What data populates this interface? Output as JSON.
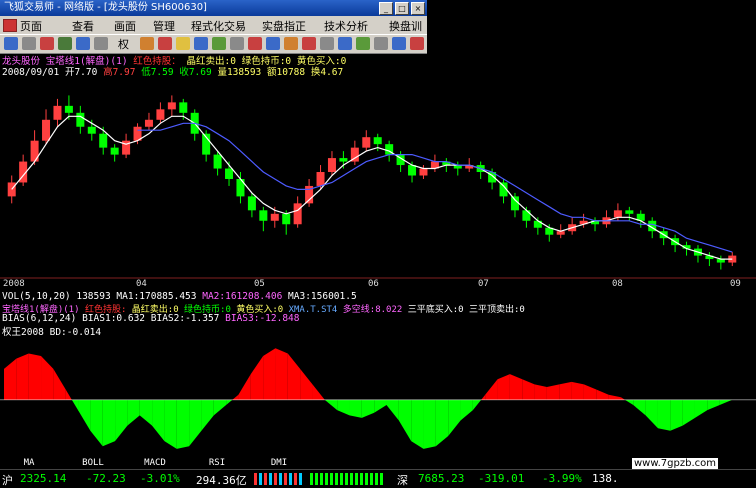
{
  "window": {
    "title": "飞狐交易师 - 网络版 - [龙头股份 SH600630]"
  },
  "menu": [
    "页面",
    "查看",
    "画面",
    "管理",
    "程式化交易",
    "实盘指正",
    "技术分析",
    "换盘训"
  ],
  "toolbar": {
    "right_button": "权"
  },
  "chart_header": {
    "line1_name": "龙头股份  宝塔线1(解盘)(1)",
    "line1_red": "红色持股：",
    "line1_rest": "晶红卖出:0  绿色持币:0  黄色买入:0",
    "line2_date": "2008/09/01",
    "line2_open": "开7.70",
    "line2_high": "高7.97",
    "line2_low": "低7.59",
    "line2_close": "收7.69",
    "line2_vol": "量138593",
    "line2_amt": "额10788",
    "line2_turn": "换4.67"
  },
  "x_axis_labels": [
    "2008",
    "04",
    "05",
    "06",
    "07",
    "08",
    "09"
  ],
  "vol_line": {
    "name": "VOL(5,10,20)  138593",
    "ma1": "MA1:170885.453",
    "ma2": "MA2:161208.406",
    "ma3": "MA3:156001.5"
  },
  "indicator_line": {
    "name": "宝塔线1(解盘)(1)",
    "red": "红色持股:",
    "a": "晶红卖出:0",
    "b": "绿色持币:0",
    "c": "黄色买入:0",
    "d": "XMA.T.ST4",
    "e": "多空线:8.022",
    "f": "三平底买入:0",
    "g": "三平顶卖出:0"
  },
  "bias_line": {
    "name": "BIAS(6,12,24)",
    "b1": "BIAS1:0.632",
    "b2": "BIAS2:-1.357",
    "b3": "BIAS3:-12.848"
  },
  "oscillator": {
    "label": "权王2008  BD:-0.014"
  },
  "bottom_tabs": [
    "MA",
    "BOLL",
    "MACD",
    "RSI",
    "DMI"
  ],
  "status": {
    "sh_label": "沪",
    "sh_index": "2325.14",
    "sh_change": "-72.23",
    "sh_pct": "-3.01%",
    "sh_amount": "294.36亿",
    "sz_label": "深",
    "sz_index": "7685.23",
    "sz_change": "-319.01",
    "sz_pct": "-3.99%",
    "sz_amount": "138."
  },
  "watermark": "www.7gpzb.com",
  "colors": {
    "up": "#ff4040",
    "down": "#00ff00",
    "buy": "#ffff00",
    "sell": "#ff66ff",
    "ma_long": "#4d5bff",
    "ma_short": "#ffffff",
    "area_red": "#ff0000",
    "area_green": "#00ff00"
  },
  "chart_data": {
    "type": "line",
    "price_candles": [
      {
        "o": 6.0,
        "c": 6.4,
        "h": 6.6,
        "l": 5.8
      },
      {
        "o": 6.4,
        "c": 7.0,
        "h": 7.2,
        "l": 6.3
      },
      {
        "o": 7.0,
        "c": 7.6,
        "h": 7.9,
        "l": 6.9
      },
      {
        "o": 7.6,
        "c": 8.2,
        "h": 8.5,
        "l": 7.5
      },
      {
        "o": 8.2,
        "c": 8.6,
        "h": 8.8,
        "l": 8.0
      },
      {
        "o": 8.6,
        "c": 8.4,
        "h": 8.9,
        "l": 8.2
      },
      {
        "o": 8.4,
        "c": 8.0,
        "h": 8.6,
        "l": 7.8
      },
      {
        "o": 8.0,
        "c": 7.8,
        "h": 8.2,
        "l": 7.6
      },
      {
        "o": 7.8,
        "c": 7.4,
        "h": 8.0,
        "l": 7.2
      },
      {
        "o": 7.4,
        "c": 7.2,
        "h": 7.5,
        "l": 7.0
      },
      {
        "o": 7.2,
        "c": 7.6,
        "h": 7.8,
        "l": 7.1
      },
      {
        "o": 7.6,
        "c": 8.0,
        "h": 8.1,
        "l": 7.5
      },
      {
        "o": 8.0,
        "c": 8.2,
        "h": 8.4,
        "l": 7.9
      },
      {
        "o": 8.2,
        "c": 8.5,
        "h": 8.7,
        "l": 8.1
      },
      {
        "o": 8.5,
        "c": 8.7,
        "h": 8.9,
        "l": 8.3
      },
      {
        "o": 8.7,
        "c": 8.4,
        "h": 8.8,
        "l": 8.2
      },
      {
        "o": 8.4,
        "c": 7.8,
        "h": 8.5,
        "l": 7.6
      },
      {
        "o": 7.8,
        "c": 7.2,
        "h": 7.9,
        "l": 7.0
      },
      {
        "o": 7.2,
        "c": 6.8,
        "h": 7.3,
        "l": 6.6
      },
      {
        "o": 6.8,
        "c": 6.5,
        "h": 7.0,
        "l": 6.3
      },
      {
        "o": 6.5,
        "c": 6.0,
        "h": 6.7,
        "l": 5.8
      },
      {
        "o": 6.0,
        "c": 5.6,
        "h": 6.1,
        "l": 5.4
      },
      {
        "o": 5.6,
        "c": 5.3,
        "h": 5.7,
        "l": 5.0
      },
      {
        "o": 5.3,
        "c": 5.5,
        "h": 5.7,
        "l": 5.1
      },
      {
        "o": 5.5,
        "c": 5.2,
        "h": 5.6,
        "l": 4.9
      },
      {
        "o": 5.2,
        "c": 5.8,
        "h": 6.0,
        "l": 5.1
      },
      {
        "o": 5.8,
        "c": 6.3,
        "h": 6.5,
        "l": 5.7
      },
      {
        "o": 6.3,
        "c": 6.7,
        "h": 6.9,
        "l": 6.2
      },
      {
        "o": 6.7,
        "c": 7.1,
        "h": 7.3,
        "l": 6.6
      },
      {
        "o": 7.1,
        "c": 7.0,
        "h": 7.3,
        "l": 6.8
      },
      {
        "o": 7.0,
        "c": 7.4,
        "h": 7.6,
        "l": 6.9
      },
      {
        "o": 7.4,
        "c": 7.7,
        "h": 7.9,
        "l": 7.3
      },
      {
        "o": 7.7,
        "c": 7.5,
        "h": 7.8,
        "l": 7.3
      },
      {
        "o": 7.5,
        "c": 7.2,
        "h": 7.6,
        "l": 7.0
      },
      {
        "o": 7.2,
        "c": 6.9,
        "h": 7.3,
        "l": 6.7
      },
      {
        "o": 6.9,
        "c": 6.6,
        "h": 7.0,
        "l": 6.4
      },
      {
        "o": 6.6,
        "c": 6.8,
        "h": 6.9,
        "l": 6.5
      },
      {
        "o": 6.8,
        "c": 7.0,
        "h": 7.2,
        "l": 6.7
      },
      {
        "o": 7.0,
        "c": 6.9,
        "h": 7.1,
        "l": 6.7
      },
      {
        "o": 6.9,
        "c": 6.8,
        "h": 7.0,
        "l": 6.6
      },
      {
        "o": 6.8,
        "c": 6.9,
        "h": 7.1,
        "l": 6.7
      },
      {
        "o": 6.9,
        "c": 6.7,
        "h": 7.0,
        "l": 6.5
      },
      {
        "o": 6.7,
        "c": 6.4,
        "h": 6.8,
        "l": 6.2
      },
      {
        "o": 6.4,
        "c": 6.0,
        "h": 6.5,
        "l": 5.8
      },
      {
        "o": 6.0,
        "c": 5.6,
        "h": 6.1,
        "l": 5.4
      },
      {
        "o": 5.6,
        "c": 5.3,
        "h": 5.7,
        "l": 5.1
      },
      {
        "o": 5.3,
        "c": 5.1,
        "h": 5.4,
        "l": 4.9
      },
      {
        "o": 5.1,
        "c": 4.9,
        "h": 5.2,
        "l": 4.7
      },
      {
        "o": 4.9,
        "c": 5.0,
        "h": 5.2,
        "l": 4.8
      },
      {
        "o": 5.0,
        "c": 5.2,
        "h": 5.4,
        "l": 4.9
      },
      {
        "o": 5.2,
        "c": 5.3,
        "h": 5.5,
        "l": 5.1
      },
      {
        "o": 5.3,
        "c": 5.2,
        "h": 5.4,
        "l": 5.0
      },
      {
        "o": 5.2,
        "c": 5.4,
        "h": 5.6,
        "l": 5.1
      },
      {
        "o": 5.4,
        "c": 5.6,
        "h": 5.8,
        "l": 5.3
      },
      {
        "o": 5.6,
        "c": 5.5,
        "h": 5.7,
        "l": 5.3
      },
      {
        "o": 5.5,
        "c": 5.3,
        "h": 5.6,
        "l": 5.1
      },
      {
        "o": 5.3,
        "c": 5.0,
        "h": 5.4,
        "l": 4.8
      },
      {
        "o": 5.0,
        "c": 4.8,
        "h": 5.1,
        "l": 4.6
      },
      {
        "o": 4.8,
        "c": 4.6,
        "h": 4.9,
        "l": 4.4
      },
      {
        "o": 4.6,
        "c": 4.5,
        "h": 4.7,
        "l": 4.3
      },
      {
        "o": 4.5,
        "c": 4.3,
        "h": 4.6,
        "l": 4.1
      },
      {
        "o": 4.3,
        "c": 4.2,
        "h": 4.4,
        "l": 4.0
      },
      {
        "o": 4.2,
        "c": 4.1,
        "h": 4.3,
        "l": 3.9
      },
      {
        "o": 4.1,
        "c": 4.3,
        "h": 4.4,
        "l": 4.0
      }
    ],
    "ma_short": [
      6.2,
      6.6,
      7.0,
      7.5,
      8.0,
      8.3,
      8.3,
      8.1,
      7.9,
      7.6,
      7.5,
      7.6,
      7.8,
      8.1,
      8.3,
      8.3,
      8.1,
      7.7,
      7.3,
      6.9,
      6.5,
      6.1,
      5.8,
      5.6,
      5.5,
      5.6,
      5.9,
      6.2,
      6.6,
      6.9,
      7.1,
      7.3,
      7.4,
      7.3,
      7.1,
      6.9,
      6.8,
      6.8,
      6.9,
      6.9,
      6.9,
      6.8,
      6.6,
      6.3,
      5.9,
      5.6,
      5.3,
      5.1,
      5.0,
      5.1,
      5.2,
      5.3,
      5.3,
      5.4,
      5.4,
      5.3,
      5.1,
      4.9,
      4.7,
      4.5,
      4.4,
      4.3,
      4.2,
      4.2
    ],
    "ma_long": [
      null,
      null,
      null,
      null,
      null,
      null,
      null,
      null,
      null,
      null,
      null,
      7.9,
      7.9,
      7.9,
      8.0,
      8.1,
      8.1,
      8.0,
      7.8,
      7.6,
      7.3,
      7.0,
      6.7,
      6.5,
      6.3,
      6.2,
      6.2,
      6.3,
      6.4,
      6.6,
      6.8,
      7.0,
      7.1,
      7.2,
      7.2,
      7.2,
      7.1,
      7.0,
      7.0,
      6.9,
      6.9,
      6.8,
      6.7,
      6.5,
      6.3,
      6.1,
      5.9,
      5.7,
      5.5,
      5.4,
      5.4,
      5.3,
      5.3,
      5.3,
      5.3,
      5.2,
      5.2,
      5.1,
      5.0,
      4.8,
      4.7,
      4.6,
      4.5,
      4.4
    ],
    "oscillator": [
      0.6,
      0.8,
      0.9,
      0.85,
      0.6,
      0.2,
      -0.2,
      -0.6,
      -0.9,
      -0.8,
      -0.5,
      -0.3,
      -0.5,
      -0.8,
      -0.95,
      -0.9,
      -0.6,
      -0.3,
      -0.1,
      0.1,
      0.5,
      0.85,
      1.0,
      0.9,
      0.6,
      0.3,
      0.0,
      -0.2,
      -0.3,
      -0.35,
      -0.25,
      -0.1,
      -0.4,
      -0.8,
      -0.95,
      -0.9,
      -0.7,
      -0.4,
      -0.2,
      0.1,
      0.4,
      0.5,
      0.4,
      0.3,
      0.25,
      0.3,
      0.35,
      0.3,
      0.2,
      0.1,
      0.05,
      -0.1,
      -0.3,
      -0.55,
      -0.6,
      -0.5,
      -0.35,
      -0.2,
      -0.1,
      0.0
    ],
    "ylim_price": [
      3.8,
      9.4
    ],
    "ylim_osc": [
      -1.05,
      1.2
    ],
    "x_axis_labels": [
      "2008",
      "04",
      "05",
      "06",
      "07",
      "08",
      "09"
    ]
  }
}
